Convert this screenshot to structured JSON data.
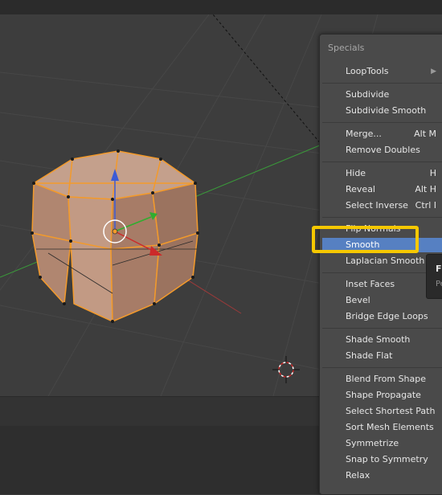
{
  "menu": {
    "title": "Specials",
    "items": [
      {
        "label": "LoopTools",
        "shortcut": "",
        "submenu": true
      },
      {
        "label": "Subdivide",
        "shortcut": ""
      },
      {
        "label": "Subdivide Smooth",
        "shortcut": ""
      },
      {
        "label": "Merge...",
        "shortcut": "Alt M"
      },
      {
        "label": "Remove Doubles",
        "shortcut": ""
      },
      {
        "label": "Hide",
        "shortcut": "H"
      },
      {
        "label": "Reveal",
        "shortcut": "Alt H"
      },
      {
        "label": "Select Inverse",
        "shortcut": "Ctrl I"
      },
      {
        "label": "Flip Normals",
        "shortcut": ""
      },
      {
        "label": "Smooth",
        "shortcut": "",
        "active": true
      },
      {
        "label": "Laplacian Smooth",
        "shortcut": ""
      },
      {
        "label": "Inset Faces",
        "shortcut": ""
      },
      {
        "label": "Bevel",
        "shortcut": ""
      },
      {
        "label": "Bridge Edge Loops",
        "shortcut": ""
      },
      {
        "label": "Shade Smooth",
        "shortcut": ""
      },
      {
        "label": "Shade Flat",
        "shortcut": ""
      },
      {
        "label": "Blend From Shape",
        "shortcut": ""
      },
      {
        "label": "Shape Propagate",
        "shortcut": ""
      },
      {
        "label": "Select Shortest Path",
        "shortcut": ""
      },
      {
        "label": "Sort Mesh Elements",
        "shortcut": ""
      },
      {
        "label": "Symmetrize",
        "shortcut": ""
      },
      {
        "label": "Snap to Symmetry",
        "shortcut": ""
      },
      {
        "label": "Relax",
        "shortcut": ""
      }
    ]
  },
  "tooltip": {
    "title": "Fl",
    "desc": "Pe"
  },
  "colors": {
    "accent": "#5680c2",
    "highlight": "#f6c800",
    "mesh_selected": "#f39a2b"
  }
}
